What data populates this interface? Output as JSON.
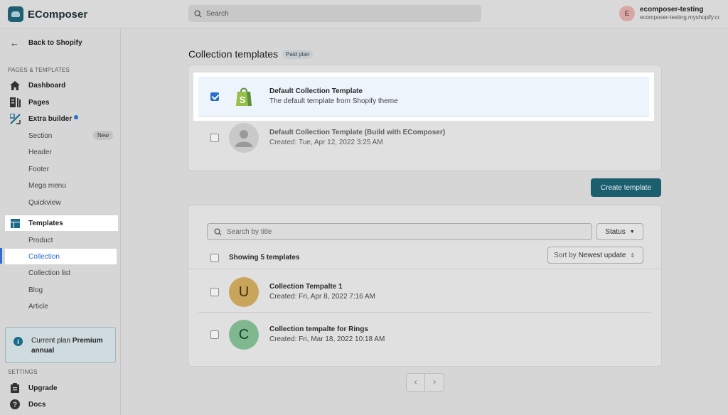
{
  "app": {
    "name": "EComposer"
  },
  "topbar": {
    "search_placeholder": "Search",
    "user": {
      "initial": "E",
      "name": "ecomposer-testing",
      "shop": "ecomposer-testing.myshopify.com"
    }
  },
  "sidebar": {
    "back_label": "Back to Shopify",
    "section_pages": "PAGES & TEMPLATES",
    "items": {
      "dashboard": "Dashboard",
      "pages": "Pages",
      "extra_builder": "Extra builder",
      "section": "Section",
      "section_badge": "New",
      "header": "Header",
      "footer": "Footer",
      "mega_menu": "Mega menu",
      "quickview": "Quickview",
      "templates": "Templates",
      "product": "Product",
      "collection": "Collection",
      "collection_list": "Collection list",
      "blog": "Blog",
      "article": "Article"
    },
    "plan": {
      "prefix": "Current plan",
      "name": "Premium annual"
    },
    "section_settings": "SETTINGS",
    "settings_items": {
      "upgrade": "Upgrade",
      "docs": "Docs"
    }
  },
  "main": {
    "title": "Collection templates",
    "plan_badge": "Paid plan",
    "default_templates": [
      {
        "name": "Default Collection Template",
        "subtitle": "The default template from Shopify theme",
        "checked": true
      },
      {
        "name": "Default Collection Template (Build with EComposer)",
        "subtitle": "Created: Tue, Apr 12, 2022 3:25 AM",
        "checked": false
      }
    ],
    "create_button": "Create template",
    "filter": {
      "search_placeholder": "Search by title",
      "status_label": "Status",
      "showing": "Showing 5 templates",
      "sort_prefix": "Sort by",
      "sort_value": "Newest update"
    },
    "templates": [
      {
        "initial": "U",
        "color": "#c9a55b",
        "name": "Collection Tempalte 1",
        "created": "Created: Fri, Apr 8, 2022 7:16 AM"
      },
      {
        "initial": "C",
        "color": "#7fb88f",
        "name": "Collection tempalte for Rings",
        "created": "Created: Fri, Mar 18, 2022 10:18 AM"
      }
    ],
    "pager": {
      "prev": "‹",
      "next": "›"
    }
  },
  "colors": {
    "accent": "#2c6ecb",
    "primary_button": "#1b5f6f",
    "shopify_green": "#95bf47"
  }
}
